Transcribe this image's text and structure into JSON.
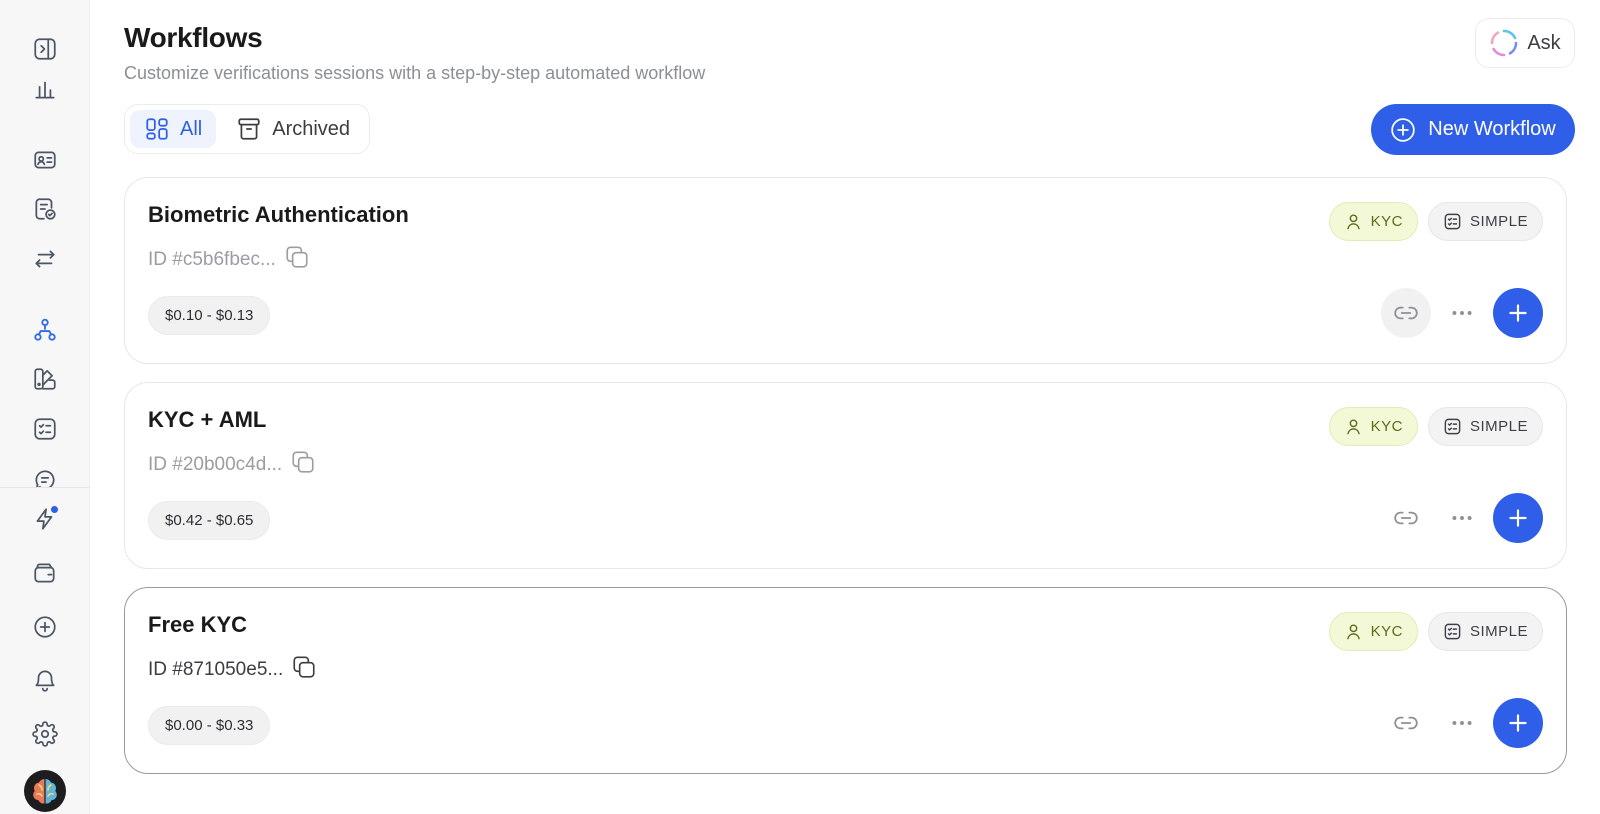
{
  "page": {
    "title": "Workflows",
    "subtitle": "Customize verifications sessions with a step-by-step automated workflow"
  },
  "ask_button": {
    "label": "Ask"
  },
  "tabs": [
    {
      "label": "All",
      "active": true
    },
    {
      "label": "Archived",
      "active": false
    }
  ],
  "new_workflow_button": {
    "label": "New Workflow"
  },
  "sidebar": {
    "icons": [
      "sidebar-toggle-icon",
      "chart-icon",
      "id-card-icon",
      "document-check-icon",
      "transfer-arrows-icon",
      "workflow-icon",
      "palette-icon",
      "checklist-icon",
      "chat-icon",
      "bolt-icon",
      "wallet-icon",
      "plus-circle-icon",
      "bell-icon",
      "gear-icon"
    ],
    "active": "workflow-icon",
    "notification_dot": true
  },
  "workflows": [
    {
      "name": "Biometric Authentication",
      "id": "ID #c5b6fbec...",
      "price": "$0.10 - $0.13",
      "badges": {
        "type": "KYC",
        "mode": "SIMPLE"
      },
      "selected": false
    },
    {
      "name": "KYC + AML",
      "id": "ID #20b00c4d...",
      "price": "$0.42 - $0.65",
      "badges": {
        "type": "KYC",
        "mode": "SIMPLE"
      },
      "selected": false
    },
    {
      "name": "Free KYC",
      "id": "ID #871050e5...",
      "price": "$0.00 - $0.33",
      "badges": {
        "type": "KYC",
        "mode": "SIMPLE"
      },
      "selected": true
    }
  ],
  "colors": {
    "accent": "#2f5fe8",
    "kyc_badge_bg": "#f3f9d6",
    "kyc_badge_text": "#5c6b1c"
  }
}
